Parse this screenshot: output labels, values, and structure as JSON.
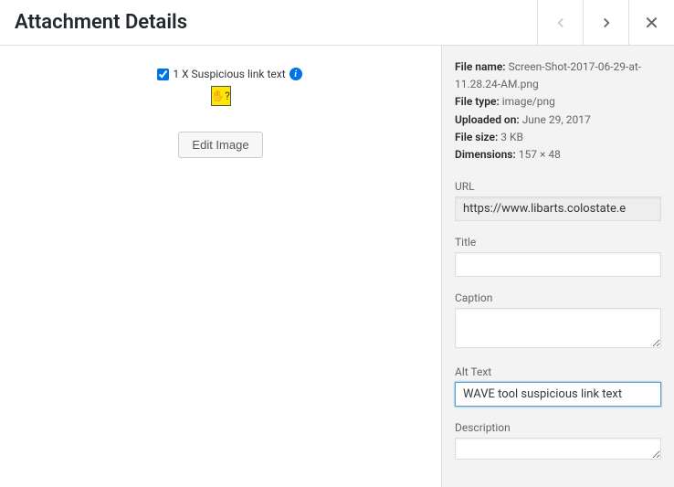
{
  "header": {
    "title": "Attachment Details"
  },
  "wave": {
    "label": "1 X Suspicious link text",
    "thumb_text": "✋?"
  },
  "edit_button": "Edit Image",
  "meta": {
    "file_name_label": "File name:",
    "file_name": "Screen-Shot-2017-06-29-at-11.28.24-AM.png",
    "file_type_label": "File type:",
    "file_type": "image/png",
    "uploaded_label": "Uploaded on:",
    "uploaded": "June 29, 2017",
    "file_size_label": "File size:",
    "file_size": "3 KB",
    "dimensions_label": "Dimensions:",
    "dimensions": "157 × 48"
  },
  "fields": {
    "url_label": "URL",
    "url_value": "https://www.libarts.colostate.e",
    "title_label": "Title",
    "title_value": "",
    "caption_label": "Caption",
    "caption_value": "",
    "alt_label": "Alt Text",
    "alt_value": "WAVE tool suspicious link text",
    "description_label": "Description",
    "description_value": ""
  }
}
